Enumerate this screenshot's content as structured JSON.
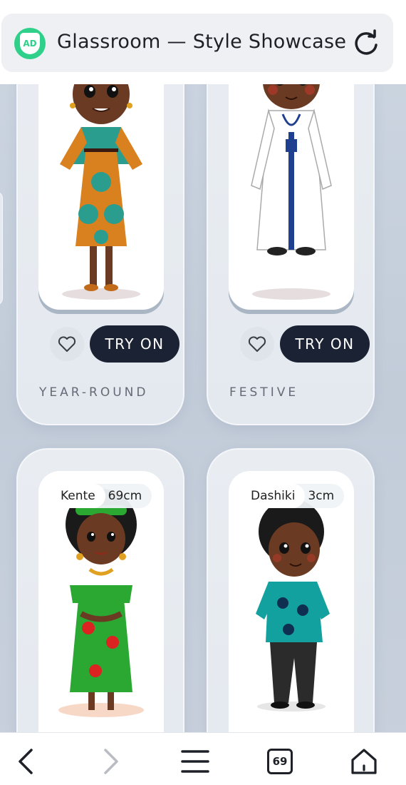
{
  "browser": {
    "site_badge": "AD",
    "title": "Glassroom — Style Showcase"
  },
  "cards": [
    {
      "season": "YEAR-ROUND",
      "try_on": "TRY ON"
    },
    {
      "season": "FESTIVE",
      "try_on": "TRY ON"
    },
    {
      "tag_name": "Kente",
      "tag_size": "69cm"
    },
    {
      "tag_name": "Dashiki",
      "tag_size": "3cm"
    }
  ],
  "bottom_nav": {
    "tab_count": "69"
  },
  "colors": {
    "accent": "#2fd08a",
    "button": "#1b2233"
  }
}
